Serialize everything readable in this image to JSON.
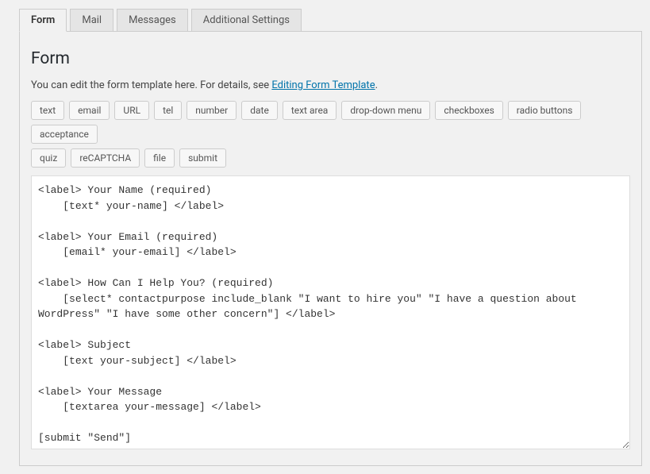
{
  "tabs": [
    {
      "label": "Form",
      "active": true
    },
    {
      "label": "Mail",
      "active": false
    },
    {
      "label": "Messages",
      "active": false
    },
    {
      "label": "Additional Settings",
      "active": false
    }
  ],
  "panel": {
    "heading": "Form",
    "description_prefix": "You can edit the form template here. For details, see ",
    "description_link": "Editing Form Template",
    "description_suffix": "."
  },
  "tag_buttons_row1": [
    "text",
    "email",
    "URL",
    "tel",
    "number",
    "date",
    "text area",
    "drop-down menu",
    "checkboxes",
    "radio buttons",
    "acceptance"
  ],
  "tag_buttons_row2": [
    "quiz",
    "reCAPTCHA",
    "file",
    "submit"
  ],
  "form_template": "<label> Your Name (required)\n    [text* your-name] </label>\n\n<label> Your Email (required)\n    [email* your-email] </label>\n\n<label> How Can I Help You? (required)\n    [select* contactpurpose include_blank \"I want to hire you\" \"I have a question about WordPress\" \"I have some other concern\"] </label>\n\n<label> Subject\n    [text your-subject] </label>\n\n<label> Your Message\n    [textarea your-message] </label>\n\n[submit \"Send\"]"
}
